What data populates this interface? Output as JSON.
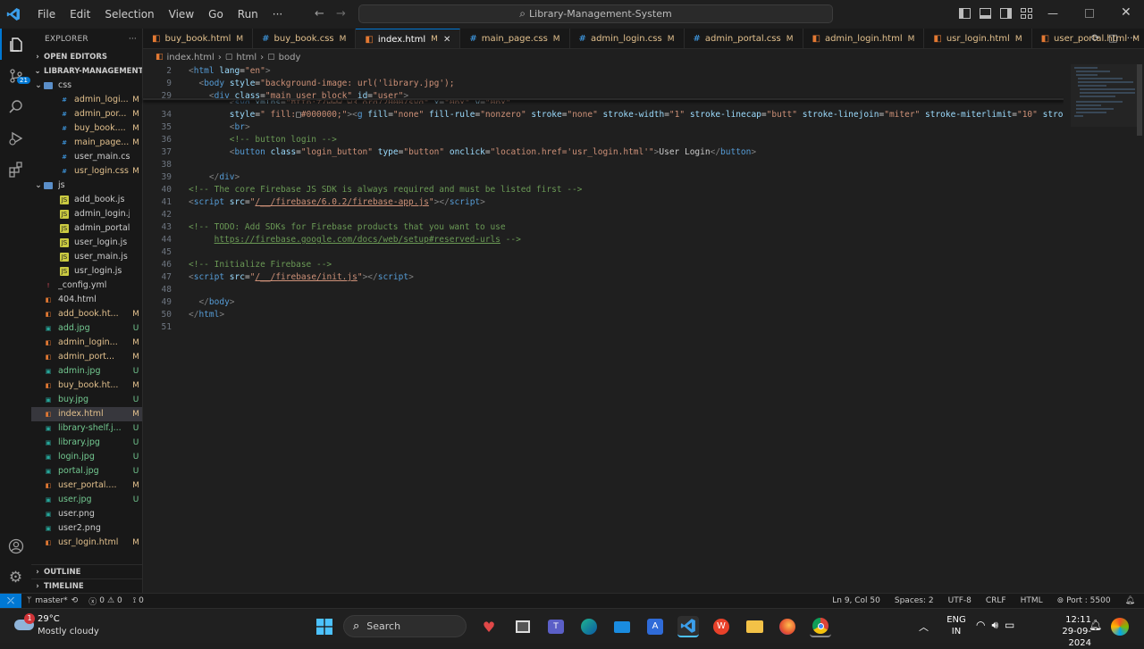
{
  "titlebar": {
    "menu": [
      "File",
      "Edit",
      "Selection",
      "View",
      "Go",
      "Run",
      "···"
    ],
    "search": "Library-Management-System"
  },
  "sidebar": {
    "explorer": "EXPLORER",
    "open_editors": "OPEN EDITORS",
    "project": "LIBRARY-MANAGEMENT-...",
    "outline": "OUTLINE",
    "timeline": "TIMELINE",
    "tree": [
      {
        "name": "css",
        "status": "",
        "type": "folder",
        "indent": 1
      },
      {
        "name": "admin_logi...",
        "status": "M",
        "type": "css",
        "indent": 2
      },
      {
        "name": "admin_por...",
        "status": "M",
        "type": "css",
        "indent": 2
      },
      {
        "name": "buy_book....",
        "status": "M",
        "type": "css",
        "indent": 2
      },
      {
        "name": "main_page....",
        "status": "M",
        "type": "css",
        "indent": 2
      },
      {
        "name": "user_main.css",
        "status": "",
        "type": "css",
        "indent": 2
      },
      {
        "name": "usr_login.css",
        "status": "M",
        "type": "css",
        "indent": 2
      },
      {
        "name": "js",
        "status": "",
        "type": "folder",
        "indent": 1
      },
      {
        "name": "add_book.js",
        "status": "",
        "type": "js",
        "indent": 2
      },
      {
        "name": "admin_login.js",
        "status": "",
        "type": "js",
        "indent": 2
      },
      {
        "name": "admin_portal.js",
        "status": "",
        "type": "js",
        "indent": 2
      },
      {
        "name": "user_login.js",
        "status": "",
        "type": "js",
        "indent": 2
      },
      {
        "name": "user_main.js",
        "status": "",
        "type": "js",
        "indent": 2
      },
      {
        "name": "usr_login.js",
        "status": "",
        "type": "js",
        "indent": 2
      },
      {
        "name": "_config.yml",
        "status": "",
        "type": "yml",
        "indent": 1
      },
      {
        "name": "404.html",
        "status": "",
        "type": "html",
        "indent": 1
      },
      {
        "name": "add_book.ht...",
        "status": "M",
        "type": "html",
        "indent": 1
      },
      {
        "name": "add.jpg",
        "status": "U",
        "type": "img",
        "indent": 1
      },
      {
        "name": "admin_login...",
        "status": "M",
        "type": "html",
        "indent": 1
      },
      {
        "name": "admin_port...",
        "status": "M",
        "type": "html",
        "indent": 1
      },
      {
        "name": "admin.jpg",
        "status": "U",
        "type": "img",
        "indent": 1
      },
      {
        "name": "buy_book.ht...",
        "status": "M",
        "type": "html",
        "indent": 1
      },
      {
        "name": "buy.jpg",
        "status": "U",
        "type": "img",
        "indent": 1
      },
      {
        "name": "index.html",
        "status": "M",
        "type": "html",
        "indent": 1,
        "selected": true
      },
      {
        "name": "library-shelf.j...",
        "status": "U",
        "type": "img",
        "indent": 1
      },
      {
        "name": "library.jpg",
        "status": "U",
        "type": "img",
        "indent": 1
      },
      {
        "name": "login.jpg",
        "status": "U",
        "type": "img",
        "indent": 1
      },
      {
        "name": "portal.jpg",
        "status": "U",
        "type": "img",
        "indent": 1
      },
      {
        "name": "user_portal....",
        "status": "M",
        "type": "html",
        "indent": 1
      },
      {
        "name": "user.jpg",
        "status": "U",
        "type": "img",
        "indent": 1
      },
      {
        "name": "user.png",
        "status": "",
        "type": "img",
        "indent": 1
      },
      {
        "name": "user2.png",
        "status": "",
        "type": "img",
        "indent": 1
      },
      {
        "name": "usr_login.html",
        "status": "M",
        "type": "html",
        "indent": 1
      }
    ]
  },
  "tabs": [
    {
      "label": "buy_book.html",
      "status": "M",
      "type": "html"
    },
    {
      "label": "buy_book.css",
      "status": "M",
      "type": "css"
    },
    {
      "label": "index.html",
      "status": "M",
      "type": "html",
      "active": true
    },
    {
      "label": "main_page.css",
      "status": "M",
      "type": "css"
    },
    {
      "label": "admin_login.css",
      "status": "M",
      "type": "css"
    },
    {
      "label": "admin_portal.css",
      "status": "M",
      "type": "css"
    },
    {
      "label": "admin_login.html",
      "status": "M",
      "type": "html"
    },
    {
      "label": "usr_login.html",
      "status": "M",
      "type": "html"
    },
    {
      "label": "user_portal.html",
      "status": "M",
      "type": "html"
    }
  ],
  "breadcrumb": [
    "index.html",
    "html",
    "body"
  ],
  "code_lines": [
    {
      "n": "2",
      "html": "<span class='t'>&lt;</span><span class='tg'>html</span> <span class='at'>lang</span>=<span class='sv'>\"en\"</span><span class='t'>&gt;</span>"
    },
    {
      "n": "9",
      "html": "  <span class='t'>&lt;</span><span class='tg'>body</span> <span class='at'>style</span>=<span class='sv'>\"background-image: url('library.jpg');</span>"
    },
    {
      "n": "29",
      "html": "    <span class='t'>&lt;</span><span class='tg'>div</span> <span class='at'>class</span>=<span class='sv'>\"main_user_block\"</span> <span class='at'>id</span>=<span class='sv'>\"user\"</span><span class='t'>&gt;</span>"
    },
    {
      "n": "34",
      "html": "        <span class='at'>style</span>=<span class='sv'>\" fill:</span>□<span class='sv'>#000000;\"</span><span class='t'>&gt;&lt;</span><span class='tg'>g</span> <span class='at'>fill</span>=<span class='sv'>\"none\"</span> <span class='at'>fill-rule</span>=<span class='sv'>\"nonzero\"</span> <span class='at'>stroke</span>=<span class='sv'>\"none\"</span> <span class='at'>stroke-width</span>=<span class='sv'>\"1\"</span> <span class='at'>stroke-linecap</span>=<span class='sv'>\"butt\"</span> <span class='at'>stroke-linejoin</span>=<span class='sv'>\"miter\"</span> <span class='at'>stroke-miterlimit</span>=<span class='sv'>\"10\"</span> <span class='at'>strok</span>"
    },
    {
      "n": "35",
      "html": "        <span class='t'>&lt;</span><span class='tg'>br</span><span class='t'>&gt;</span>"
    },
    {
      "n": "36",
      "html": "        <span class='cm'>&lt;!-- button login --&gt;</span>"
    },
    {
      "n": "37",
      "html": "        <span class='t'>&lt;</span><span class='tg'>button</span> <span class='at'>class</span>=<span class='sv'>\"login_button\"</span> <span class='at'>type</span>=<span class='sv'>\"button\"</span> <span class='at'>onclick</span>=<span class='sv'>\"location.href='usr_login.html'\"</span><span class='t'>&gt;</span>User Login<span class='t'>&lt;/</span><span class='tg'>button</span><span class='t'>&gt;</span>"
    },
    {
      "n": "38",
      "html": ""
    },
    {
      "n": "39",
      "html": "    <span class='t'>&lt;/</span><span class='tg'>div</span><span class='t'>&gt;</span>"
    },
    {
      "n": "40",
      "html": "<span class='cm'>&lt;!-- The core Firebase JS SDK is always required and must be listed first --&gt;</span>"
    },
    {
      "n": "41",
      "html": "<span class='t'>&lt;</span><span class='tg'>script</span> <span class='at'>src</span>=<span class='sv'>\"<u>/__/firebase/6.0.2/firebase-app.js</u>\"</span><span class='t'>&gt;&lt;/</span><span class='tg'>script</span><span class='t'>&gt;</span>"
    },
    {
      "n": "42",
      "html": ""
    },
    {
      "n": "43",
      "html": "<span class='cm'>&lt;!-- TODO: Add SDKs for Firebase products that you want to use</span>"
    },
    {
      "n": "44",
      "html": "<span class='cm'>     </span><span class='cm' style='text-decoration:underline'>https://firebase.google.com/docs/web/setup#reserved-urls</span><span class='cm'> --&gt;</span>"
    },
    {
      "n": "45",
      "html": ""
    },
    {
      "n": "46",
      "html": "<span class='cm'>&lt;!-- Initialize Firebase --&gt;</span>"
    },
    {
      "n": "47",
      "html": "<span class='t'>&lt;</span><span class='tg'>script</span> <span class='at'>src</span>=<span class='sv'>\"<u>/__/firebase/init.js</u>\"</span><span class='t'>&gt;&lt;/</span><span class='tg'>script</span><span class='t'>&gt;</span>"
    },
    {
      "n": "48",
      "html": ""
    },
    {
      "n": "49",
      "html": "  <span class='t'>&lt;/</span><span class='tg'>body</span><span class='t'>&gt;</span>"
    },
    {
      "n": "50",
      "html": "<span class='t'>&lt;/</span><span class='tg'>html</span><span class='t'>&gt;</span>"
    },
    {
      "n": "51",
      "html": ""
    }
  ],
  "statusbar": {
    "branch": "master*",
    "errors": "0",
    "warnings": "0",
    "ports": "0",
    "position": "Ln 9, Col 50",
    "spaces": "Spaces: 2",
    "encoding": "UTF-8",
    "eol": "CRLF",
    "language": "HTML",
    "port": "Port : 5500"
  },
  "taskbar": {
    "weather_temp": "29°C",
    "weather_desc": "Mostly cloudy",
    "weather_badge": "1",
    "search": "Search",
    "lang1": "ENG",
    "lang2": "IN",
    "time": "12:11",
    "date": "29-09-2024"
  },
  "colors": {
    "accent": "#0078d4",
    "modified": "#e2c08d",
    "untracked": "#73c991",
    "status_remote": "#0078d4"
  }
}
